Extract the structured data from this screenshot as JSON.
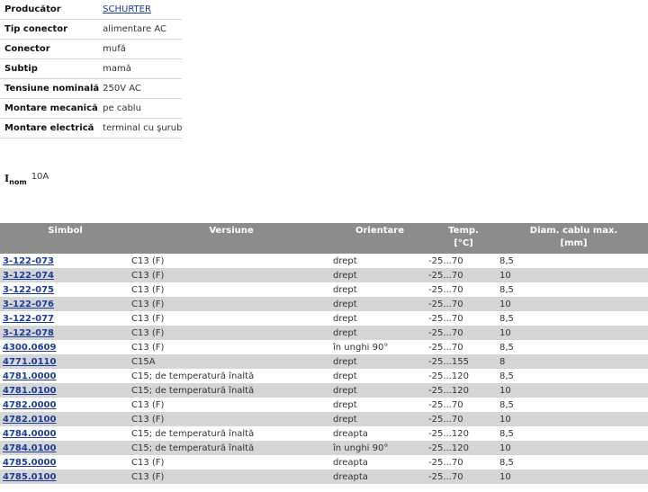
{
  "specs": [
    {
      "label": "Producător",
      "value": "SCHURTER",
      "link": true
    },
    {
      "label": "Tip conector",
      "value": "alimentare AC"
    },
    {
      "label": "Conector",
      "value": "mufă"
    },
    {
      "label": "Subtip",
      "value": "mamă"
    },
    {
      "label": "Tensiune nominală",
      "value": "250V AC"
    },
    {
      "label": "Montare mecanică",
      "value": "pe cablu"
    },
    {
      "label": "Montare electrică",
      "value": "terminal cu şurub"
    }
  ],
  "inom": {
    "symbol": "I",
    "sub": "nom",
    "value": "10A"
  },
  "table": {
    "headers": {
      "symbol": "Simbol",
      "version": "Versiune",
      "orientation": "Orientare",
      "temp_line1": "Temp.",
      "temp_line2": "[°C]",
      "diam_line1": "Diam. cablu max.",
      "diam_line2": "[mm]"
    },
    "rows": [
      {
        "symbol": "3-122-073",
        "version": "C13 (F)",
        "orientation": "drept",
        "temp": "-25...70",
        "diam": "8,5"
      },
      {
        "symbol": "3-122-074",
        "version": "C13 (F)",
        "orientation": "drept",
        "temp": "-25...70",
        "diam": "10"
      },
      {
        "symbol": "3-122-075",
        "version": "C13 (F)",
        "orientation": "drept",
        "temp": "-25...70",
        "diam": "8,5"
      },
      {
        "symbol": "3-122-076",
        "version": "C13 (F)",
        "orientation": "drept",
        "temp": "-25...70",
        "diam": "10"
      },
      {
        "symbol": "3-122-077",
        "version": "C13 (F)",
        "orientation": "drept",
        "temp": "-25...70",
        "diam": "8,5"
      },
      {
        "symbol": "3-122-078",
        "version": "C13 (F)",
        "orientation": "drept",
        "temp": "-25...70",
        "diam": "10"
      },
      {
        "symbol": "4300.0609",
        "version": "C13 (F)",
        "orientation": "în unghi 90°",
        "temp": "-25...70",
        "diam": "8,5"
      },
      {
        "symbol": "4771.0110",
        "version": "C15A",
        "orientation": "drept",
        "temp": "-25...155",
        "diam": "8"
      },
      {
        "symbol": "4781.0000",
        "version": "C15; de temperatură înaltă",
        "orientation": "drept",
        "temp": "-25...120",
        "diam": "8,5"
      },
      {
        "symbol": "4781.0100",
        "version": "C15; de temperatură înaltă",
        "orientation": "drept",
        "temp": "-25...120",
        "diam": "10"
      },
      {
        "symbol": "4782.0000",
        "version": "C13 (F)",
        "orientation": "drept",
        "temp": "-25...70",
        "diam": "8,5"
      },
      {
        "symbol": "4782.0100",
        "version": "C13 (F)",
        "orientation": "drept",
        "temp": "-25...70",
        "diam": "10"
      },
      {
        "symbol": "4784.0000",
        "version": "C15; de temperatură înaltă",
        "orientation": "dreapta",
        "temp": "-25...120",
        "diam": "8,5"
      },
      {
        "symbol": "4784.0100",
        "version": "C15; de temperatură înaltă",
        "orientation": "în unghi 90°",
        "temp": "-25...120",
        "diam": "10"
      },
      {
        "symbol": "4785.0000",
        "version": "C13 (F)",
        "orientation": "dreapta",
        "temp": "-25...70",
        "diam": "8,5"
      },
      {
        "symbol": "4785.0100",
        "version": "C13 (F)",
        "orientation": "dreapta",
        "temp": "-25...70",
        "diam": "10"
      }
    ]
  },
  "colors": {
    "link": "#1a3c9c",
    "header_bg": "#8c8c8c",
    "alt_row_bg": "#d6d6d6"
  }
}
